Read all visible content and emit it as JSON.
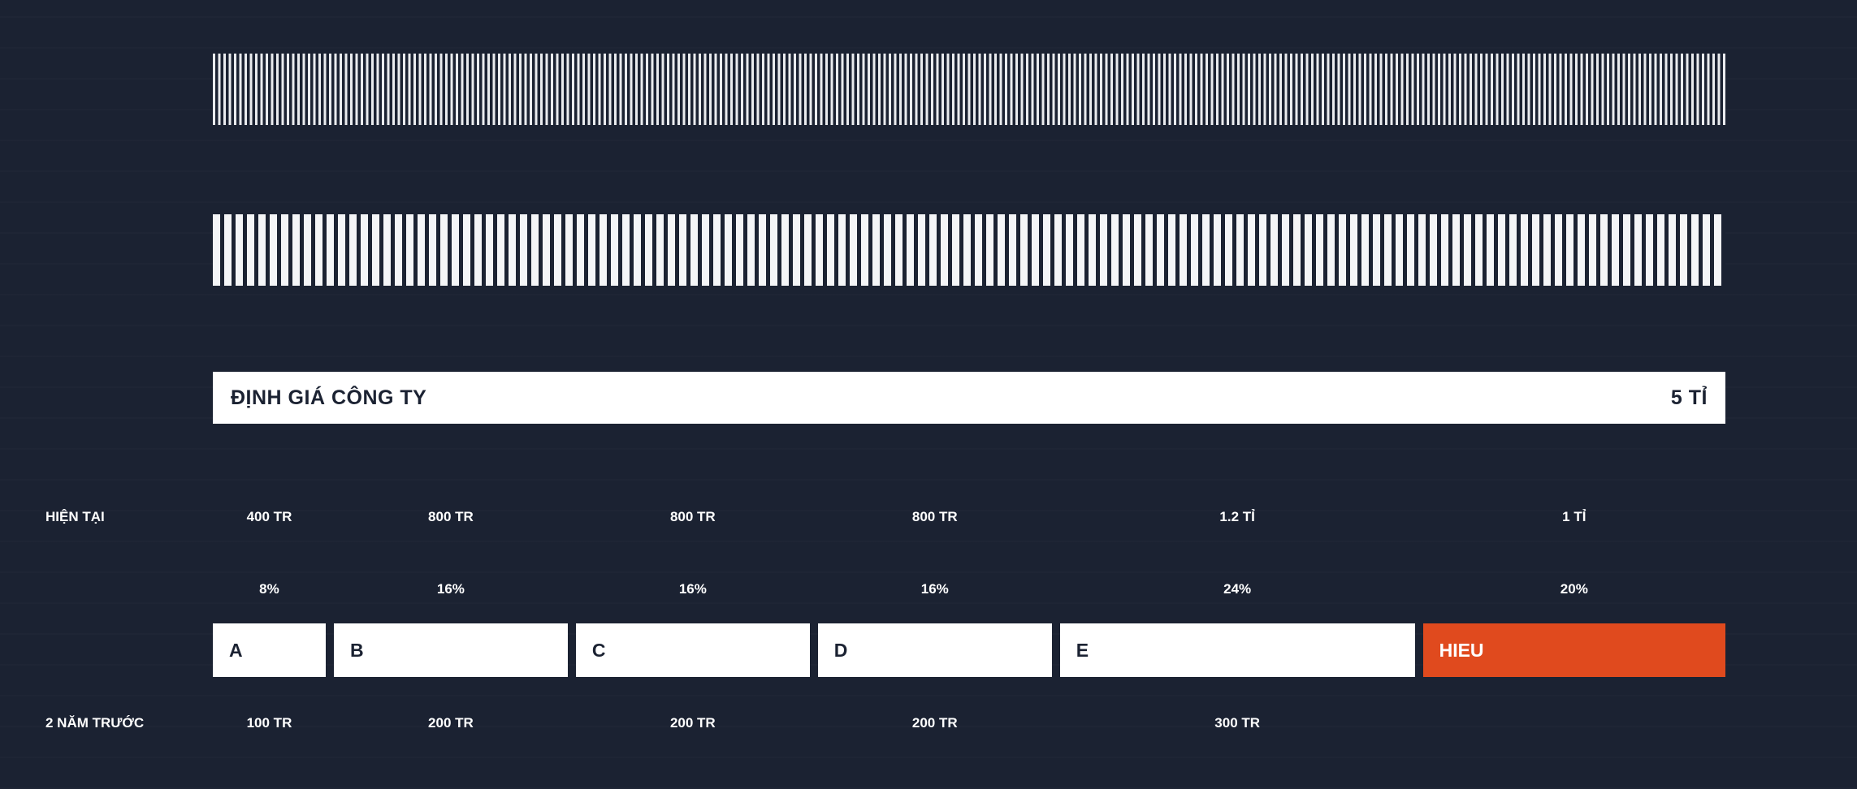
{
  "valuation": {
    "label": "ĐỊNH GIÁ CÔNG TY",
    "value": "5 TỈ"
  },
  "rows": {
    "current_label": "HIỆN TẠI",
    "past_label": "2 NĂM TRƯỚC"
  },
  "accent_color": "#e04a1e",
  "chart_data": {
    "type": "bar",
    "categories": [
      "A",
      "B",
      "C",
      "D",
      "E",
      "HIEU"
    ],
    "current_values": [
      "400 TR",
      "800 TR",
      "800 TR",
      "800 TR",
      "1.2 TỈ",
      "1 TỈ"
    ],
    "percentages": [
      "8%",
      "16%",
      "16%",
      "16%",
      "24%",
      "20%"
    ],
    "share_percent": [
      8,
      16,
      16,
      16,
      24,
      20
    ],
    "past_values": [
      "100 TR",
      "200 TR",
      "200 TR",
      "200 TR",
      "300 TR",
      ""
    ],
    "total": "5 TỈ",
    "highlight": "HIEU"
  }
}
